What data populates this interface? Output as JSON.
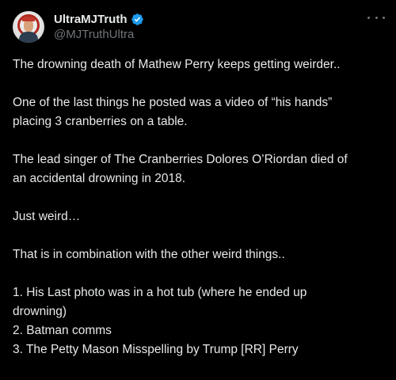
{
  "author": {
    "display_name": "UltraMJTruth",
    "handle": "@MJTruthUltra",
    "verified_badge_color": "#1d9bf0"
  },
  "menu": {
    "icon": "more-horizontal-icon"
  },
  "tweet": {
    "paragraphs": [
      {
        "lines": [
          "The drowning death of Mathew Perry keeps getting weirder.."
        ]
      },
      {
        "lines": [
          "One of the last things he posted was a video of “his hands”",
          "placing 3 cranberries on a table."
        ]
      },
      {
        "lines": [
          "The lead singer of The Cranberries Dolores O’Riordan died of",
          "an accidental drowning in 2018."
        ]
      },
      {
        "lines": [
          "Just weird…"
        ]
      },
      {
        "lines": [
          "That is in combination with the other weird things.."
        ]
      },
      {
        "lines": [
          "1. His Last photo was in a hot tub (where he ended up",
          "drowning)",
          "2. Batman comms",
          "3. The Petty Mason Misspelling by Trump [RR] Perry"
        ]
      }
    ]
  },
  "colors": {
    "background": "#000000",
    "text": "#e7e9ea",
    "secondary_text": "#71767b",
    "accent": "#1d9bf0"
  }
}
